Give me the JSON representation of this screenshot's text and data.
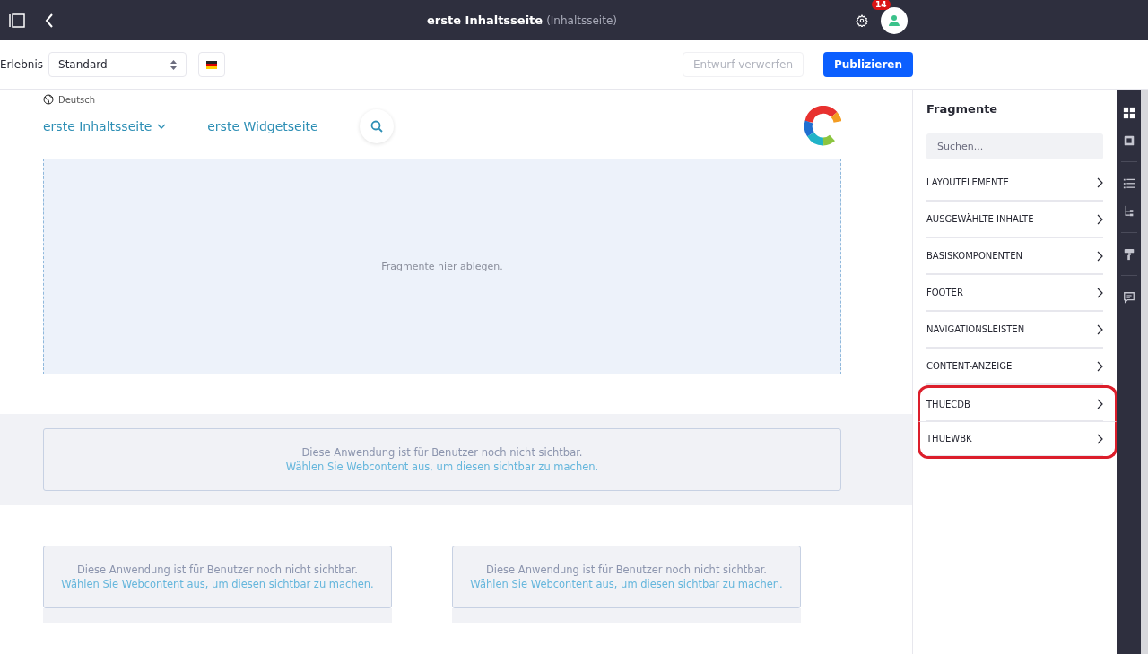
{
  "topbar": {
    "title": "erste Inhaltsseite",
    "subtitle": "(Inhaltsseite)",
    "notification_count": "14"
  },
  "toolbar": {
    "experience_label": "Erlebnis",
    "experience_value": "Standard",
    "discard_button": "Entwurf verwerfen",
    "publish_button": "Publizieren"
  },
  "page": {
    "language": "Deutsch",
    "nav": [
      {
        "label": "erste Inhaltsseite",
        "has_dropdown": true
      },
      {
        "label": "erste Widgetseite",
        "has_dropdown": false
      }
    ],
    "dropzone_text": "Fragmente hier ablegen.",
    "notices": [
      {
        "line_1": "Diese Anwendung ist für Benutzer noch nicht sichtbar.",
        "line_2": "Wählen Sie Webcontent aus, um diesen sichtbar zu machen."
      },
      {
        "line_1": "Diese Anwendung ist für Benutzer noch nicht sichtbar.",
        "line_2": "Wählen Sie Webcontent aus, um diesen sichtbar zu machen."
      },
      {
        "line_1": "Diese Anwendung ist für Benutzer noch nicht sichtbar.",
        "line_2": "Wählen Sie Webcontent aus, um diesen sichtbar zu machen."
      }
    ]
  },
  "sidebar": {
    "title": "Fragmente",
    "search": {
      "placeholder": "Suchen..."
    },
    "items": [
      {
        "label": "LAYOUTELEMENTE",
        "highlighted": false
      },
      {
        "label": "AUSGEWÄHLTE INHALTE",
        "highlighted": false
      },
      {
        "label": "BASISKOMPONENTEN",
        "highlighted": false
      },
      {
        "label": "FOOTER",
        "highlighted": false
      },
      {
        "label": "NAVIGATIONSLEISTEN",
        "highlighted": false
      },
      {
        "label": "CONTENT-ANZEIGE",
        "highlighted": false
      },
      {
        "label": "THUECDB",
        "highlighted": true
      },
      {
        "label": "THUEWBK",
        "highlighted": true
      }
    ]
  },
  "rail": {
    "items": [
      {
        "kind": "fragments",
        "selected": true
      },
      {
        "kind": "widgets",
        "selected": false
      },
      {
        "kind": "structure",
        "selected": false
      },
      {
        "kind": "tree",
        "selected": false
      },
      {
        "kind": "styles",
        "selected": false
      },
      {
        "kind": "comments",
        "selected": false
      }
    ]
  }
}
